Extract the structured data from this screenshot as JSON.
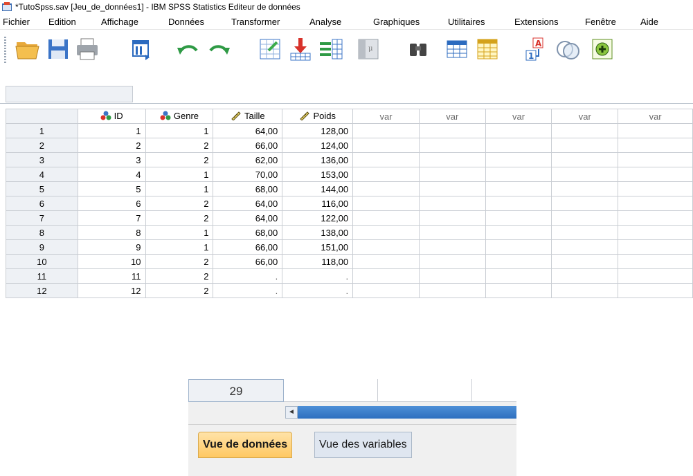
{
  "window": {
    "title": "*TutoSpss.sav [Jeu_de_données1] - IBM SPSS Statistics Editeur de données"
  },
  "menu": [
    "Fichier",
    "Edition",
    "Affichage",
    "Données",
    "Transformer",
    "Analyse",
    "Graphiques",
    "Utilitaires",
    "Extensions",
    "Fenêtre",
    "Aide"
  ],
  "toolbar": {
    "icons": [
      "open-folder-icon",
      "save-icon",
      "print-icon",
      "recall-dialog-icon",
      "undo-icon",
      "redo-icon",
      "goto-case-icon",
      "goto-variable-icon",
      "variables-icon",
      "run-descriptives-icon",
      "find-icon",
      "insert-cases-icon",
      "insert-variable-icon",
      "value-labels-icon",
      "use-sets-icon",
      "spelling-icon"
    ]
  },
  "cell_editor": {
    "value": ""
  },
  "grid": {
    "columns": [
      {
        "label": "ID",
        "icon": "nominal-icon",
        "kind": "var"
      },
      {
        "label": "Genre",
        "icon": "nominal-icon",
        "kind": "var"
      },
      {
        "label": "Taille",
        "icon": "scale-icon",
        "kind": "var"
      },
      {
        "label": "Poids",
        "icon": "scale-icon",
        "kind": "var"
      },
      {
        "label": "var",
        "kind": "empty"
      },
      {
        "label": "var",
        "kind": "empty"
      },
      {
        "label": "var",
        "kind": "empty"
      },
      {
        "label": "var",
        "kind": "empty"
      },
      {
        "label": "var",
        "kind": "empty"
      }
    ],
    "rows": [
      {
        "n": "1",
        "values": [
          "1",
          "1",
          "64,00",
          "128,00"
        ]
      },
      {
        "n": "2",
        "values": [
          "2",
          "2",
          "66,00",
          "124,00"
        ]
      },
      {
        "n": "3",
        "values": [
          "3",
          "2",
          "62,00",
          "136,00"
        ]
      },
      {
        "n": "4",
        "values": [
          "4",
          "1",
          "70,00",
          "153,00"
        ]
      },
      {
        "n": "5",
        "values": [
          "5",
          "1",
          "68,00",
          "144,00"
        ]
      },
      {
        "n": "6",
        "values": [
          "6",
          "2",
          "64,00",
          "116,00"
        ]
      },
      {
        "n": "7",
        "values": [
          "7",
          "2",
          "64,00",
          "122,00"
        ]
      },
      {
        "n": "8",
        "values": [
          "8",
          "1",
          "68,00",
          "138,00"
        ]
      },
      {
        "n": "9",
        "values": [
          "9",
          "1",
          "66,00",
          "151,00"
        ]
      },
      {
        "n": "10",
        "values": [
          "10",
          "2",
          "66,00",
          "118,00"
        ]
      },
      {
        "n": "11",
        "values": [
          "11",
          "2",
          ".",
          "."
        ]
      },
      {
        "n": "12",
        "values": [
          "12",
          "2",
          ".",
          "."
        ]
      }
    ]
  },
  "lower": {
    "row_label": "29",
    "scroll_left_glyph": "◄"
  },
  "tabs": {
    "data_view": "Vue de données",
    "variable_view": "Vue des variables"
  }
}
